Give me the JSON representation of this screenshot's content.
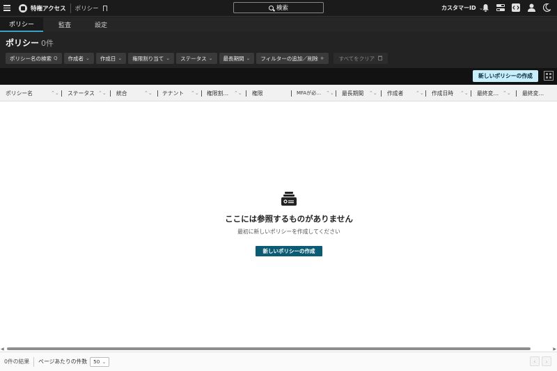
{
  "header": {
    "app_title": "特権アクセス",
    "breadcrumb": "ポリシー",
    "search_label": "検索",
    "customer_label": "カスタマーID"
  },
  "tabs": [
    {
      "label": "ポリシー",
      "active": true
    },
    {
      "label": "監査",
      "active": false
    },
    {
      "label": "設定",
      "active": false
    }
  ],
  "page": {
    "title": "ポリシー",
    "count": "0件"
  },
  "filters": [
    {
      "label": "ポリシー名の検索",
      "glyph": "Q"
    },
    {
      "label": "作成者",
      "glyph": "⌄"
    },
    {
      "label": "作成日",
      "glyph": "⌄"
    },
    {
      "label": "権限割り当て",
      "glyph": "⌄"
    },
    {
      "label": "ステータス",
      "glyph": "⌄"
    },
    {
      "label": "最長期間",
      "glyph": "⌄"
    },
    {
      "label": "フィルターの追加／削除",
      "glyph": "+"
    }
  ],
  "clear_all": "すべてをクリア",
  "create_button_top": "新しいポリシーの作成",
  "columns": [
    "ポリシー名",
    "ステータス",
    "統合",
    "テナント",
    "権限割…",
    "権限",
    "MFAが必…",
    "最長期間",
    "作成者",
    "作成日時",
    "最終変…",
    "最終変…"
  ],
  "empty": {
    "title": "ここには参照するものがありません",
    "subtitle": "最初に新しいポリシーを作成してください",
    "button": "新しいポリシーの作成"
  },
  "footer": {
    "results": "0件の結果",
    "per_page_label": "ページあたりの件数",
    "per_page_value": "50"
  },
  "colors": {
    "accent": "#3da2c7",
    "primary_button": "#0a5b73",
    "top_button": "#c8eefb"
  }
}
